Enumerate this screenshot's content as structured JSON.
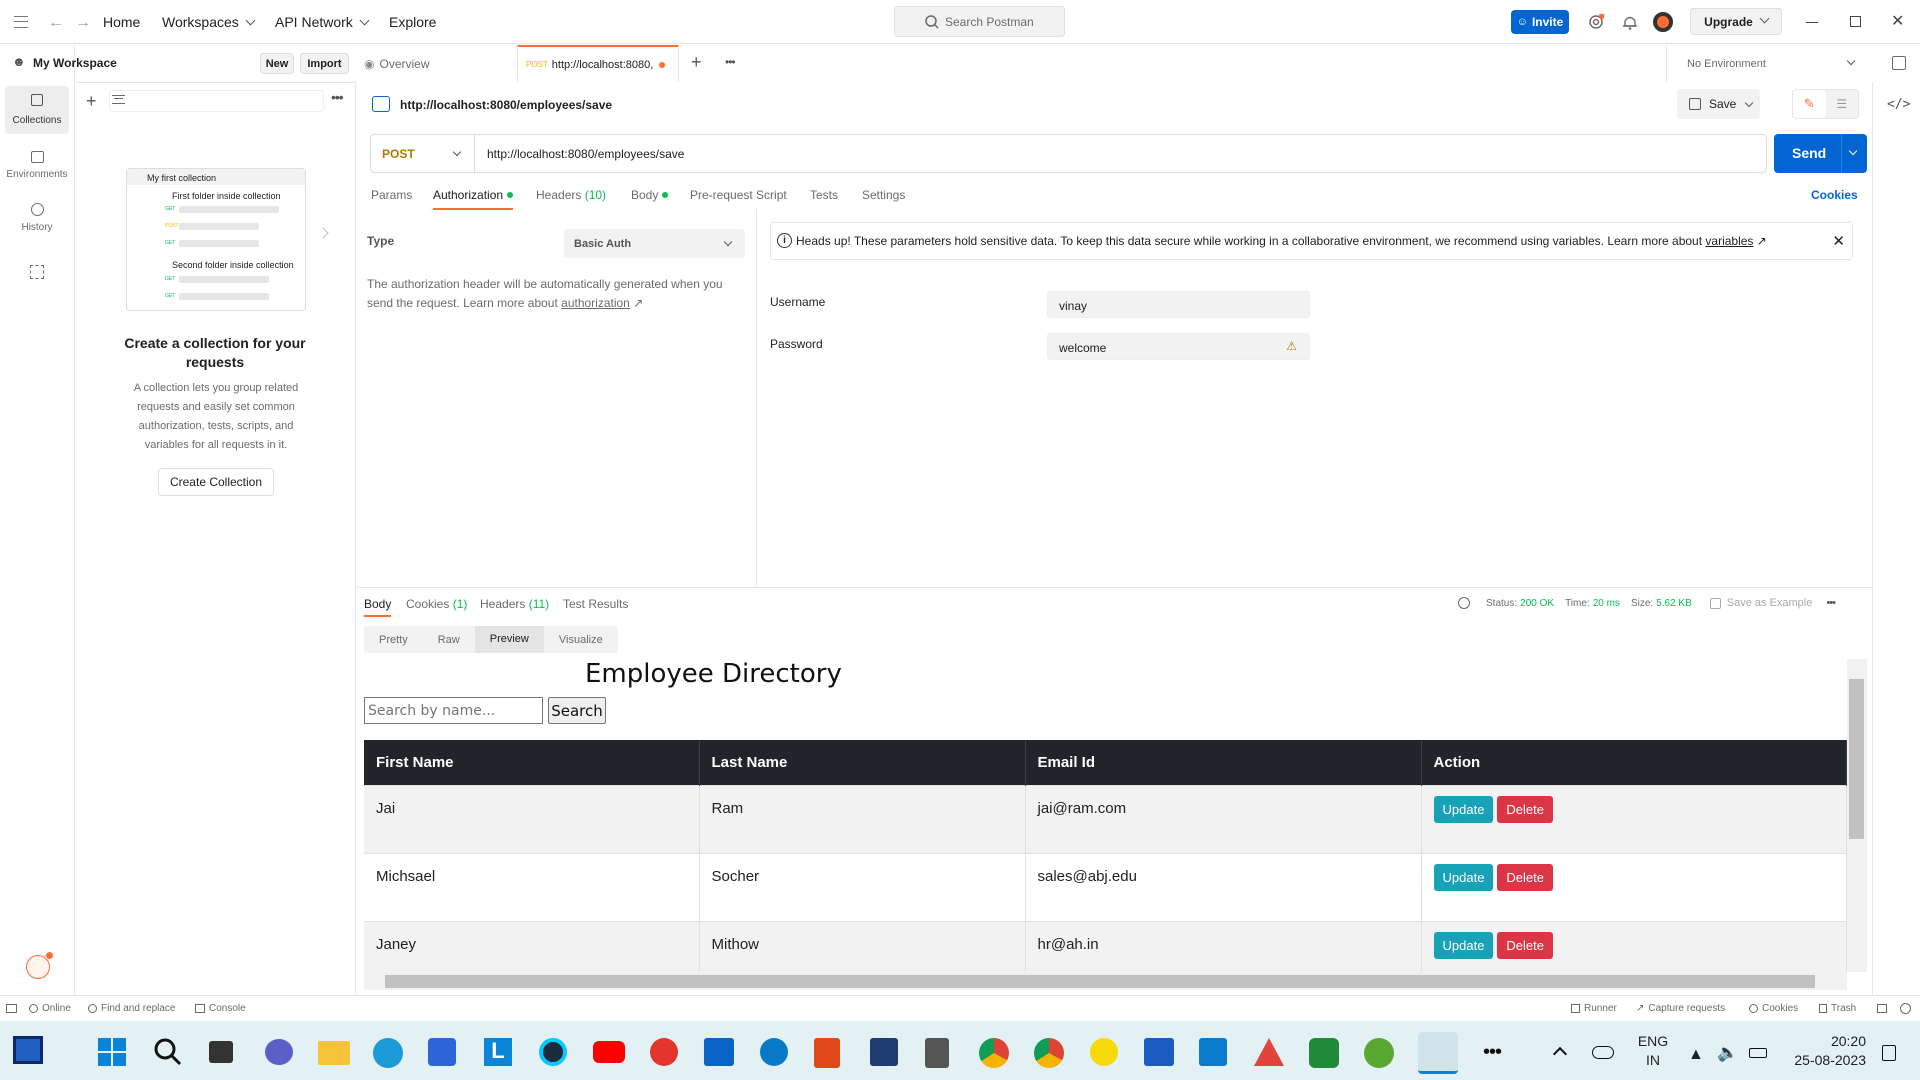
{
  "nav": {
    "home": "Home",
    "workspaces": "Workspaces",
    "api_network": "API Network",
    "explore": "Explore",
    "search_placeholder": "Search Postman",
    "invite": "Invite",
    "upgrade": "Upgrade"
  },
  "workspace": {
    "name": "My Workspace",
    "new": "New",
    "import": "Import"
  },
  "left_rail": [
    {
      "label": "Collections",
      "icon": "collections-icon"
    },
    {
      "label": "Environments",
      "icon": "environments-icon"
    },
    {
      "label": "History",
      "icon": "history-icon"
    }
  ],
  "collection_preview": {
    "title": "My first collection",
    "folder1": "First folder inside collection",
    "folder2": "Second folder inside collection",
    "methods": [
      "GET",
      "POST",
      "GET",
      "GET",
      "GET"
    ]
  },
  "empty_state": {
    "heading": "Create a collection for your requests",
    "body": "A collection lets you group related requests and easily set common authorization, tests, scripts, and variables for all requests in it.",
    "button": "Create Collection"
  },
  "tabs": {
    "overview": "Overview",
    "request_method": "POST",
    "request_url": "http://localhost:8080,"
  },
  "environment": "No Environment",
  "request": {
    "title": "http://localhost:8080/employees/save",
    "save": "Save",
    "method": "POST",
    "url": "http://localhost:8080/employees/save",
    "send": "Send",
    "cookies": "Cookies"
  },
  "request_tabs": {
    "params": "Params",
    "authorization": "Authorization",
    "headers": "Headers",
    "headers_count": "(10)",
    "body": "Body",
    "prerequest": "Pre-request Script",
    "tests": "Tests",
    "settings": "Settings"
  },
  "auth": {
    "type_label": "Type",
    "type_value": "Basic Auth",
    "help_text": "The authorization header will be automatically generated when you send the request. Learn more about",
    "help_link": "authorization",
    "notice": "Heads up! These parameters hold sensitive data. To keep this data secure while working in a collaborative environment, we recommend using variables. Learn more about",
    "notice_link": "variables",
    "username_label": "Username",
    "username": "vinay",
    "password_label": "Password",
    "password": "welcome"
  },
  "response": {
    "tabs": {
      "body": "Body",
      "cookies": "Cookies",
      "cookies_count": "(1)",
      "headers": "Headers",
      "headers_count": "(11)",
      "tests": "Test Results"
    },
    "status_label": "Status:",
    "status": "200 OK",
    "time_label": "Time:",
    "time": "20 ms",
    "size_label": "Size:",
    "size": "5.62 KB",
    "save_example": "Save as Example",
    "views": {
      "pretty": "Pretty",
      "raw": "Raw",
      "preview": "Preview",
      "visualize": "Visualize"
    }
  },
  "preview": {
    "title": "Employee Directory",
    "search_placeholder": "Search by name...",
    "search_button": "Search",
    "columns": [
      "First Name",
      "Last Name",
      "Email Id",
      "Action"
    ],
    "rows": [
      {
        "first": "Jai",
        "last": "Ram",
        "email": "jai@ram.com"
      },
      {
        "first": "Michsael",
        "last": "Socher",
        "email": "sales@abj.edu"
      },
      {
        "first": "Janey",
        "last": "Mithow",
        "email": "hr@ah.in"
      }
    ],
    "update": "Update",
    "delete": "Delete"
  },
  "statusbar": {
    "online": "Online",
    "find_replace": "Find and replace",
    "console": "Console",
    "runner": "Runner",
    "capture": "Capture requests",
    "cookies": "Cookies",
    "trash": "Trash"
  },
  "taskbar": {
    "lang1": "ENG",
    "lang2": "IN",
    "time": "20:20",
    "date": "25-08-2023"
  },
  "colors": {
    "accent": "#ff6c37",
    "send": "#0265d2",
    "ok": "#0cbb52"
  }
}
